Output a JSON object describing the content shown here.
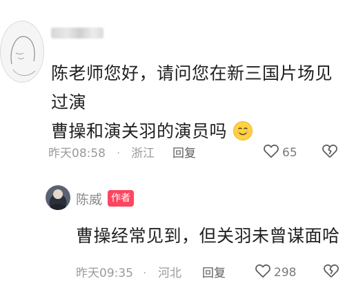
{
  "comment": {
    "username": "",
    "text_line1": "陈老师您好，请问您在新三国片场见过演",
    "text_line2": "曹操和演关羽的演员吗",
    "emoji_icon": "smiling-face-emoji",
    "time": "昨天08:58",
    "separator": "·",
    "location": "浙江",
    "reply_label": "回复",
    "like_count": "65"
  },
  "reply": {
    "author_name": "陈威",
    "author_badge": "作者",
    "text": "曹操经常见到，但关羽未曾谋面哈",
    "time": "昨天09:35",
    "separator": "·",
    "location": "河北",
    "reply_label": "回复",
    "like_count": "298"
  },
  "colors": {
    "badge": "#ff4561",
    "meta_text": "#9a9a9a",
    "body_text": "#1f1f1f"
  }
}
